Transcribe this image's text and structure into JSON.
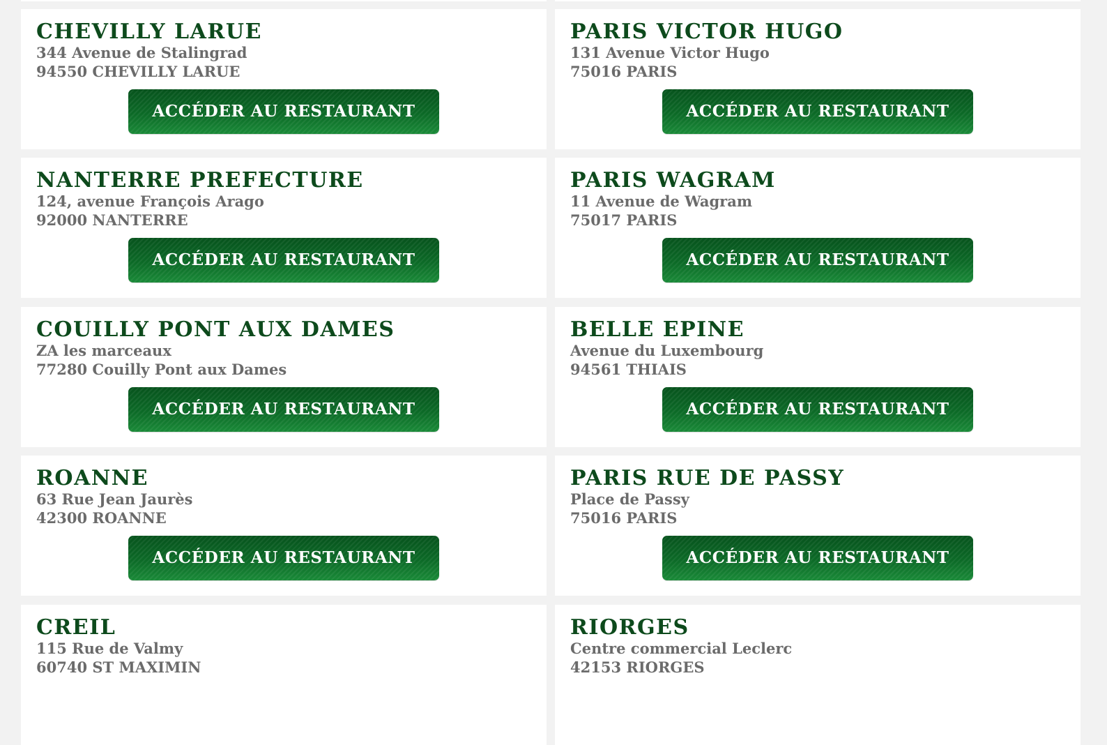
{
  "restaurants": [
    {
      "name": "CHEVILLY LARUE",
      "address_line1": "344 Avenue de Stalingrad",
      "address_line2": "94550 CHEVILLY LARUE",
      "button_label": "ACCÉDER AU RESTAURANT"
    },
    {
      "name": "PARIS VICTOR HUGO",
      "address_line1": "131 Avenue Victor Hugo",
      "address_line2": "75016 PARIS",
      "button_label": "ACCÉDER AU RESTAURANT"
    },
    {
      "name": "NANTERRE PREFECTURE",
      "address_line1": "124, avenue François Arago",
      "address_line2": "92000 NANTERRE",
      "button_label": "ACCÉDER AU RESTAURANT"
    },
    {
      "name": "PARIS WAGRAM",
      "address_line1": "11 Avenue de Wagram",
      "address_line2": "75017 PARIS",
      "button_label": "ACCÉDER AU RESTAURANT"
    },
    {
      "name": "COUILLY PONT AUX DAMES",
      "address_line1": "ZA les marceaux",
      "address_line2": "77280 Couilly Pont aux Dames",
      "button_label": "ACCÉDER AU RESTAURANT"
    },
    {
      "name": "BELLE EPINE",
      "address_line1": "Avenue du Luxembourg",
      "address_line2": "94561 THIAIS",
      "button_label": "ACCÉDER AU RESTAURANT"
    },
    {
      "name": "ROANNE",
      "address_line1": "63 Rue Jean Jaurès",
      "address_line2": "42300 ROANNE",
      "button_label": "ACCÉDER AU RESTAURANT"
    },
    {
      "name": "PARIS RUE DE PASSY",
      "address_line1": "Place de Passy",
      "address_line2": "75016 PARIS",
      "button_label": "ACCÉDER AU RESTAURANT"
    },
    {
      "name": "CREIL",
      "address_line1": "115 Rue de Valmy",
      "address_line2": "60740 ST MAXIMIN"
    },
    {
      "name": "RIORGES",
      "address_line1": "Centre commercial Leclerc",
      "address_line2": "42153 RIORGES"
    }
  ],
  "colors": {
    "page_background": "#f2f2f2",
    "card_background": "#ffffff",
    "name_text": "#0d4a1c",
    "address_text": "#6b6b6b",
    "button_green": "#0c6a27",
    "button_text": "#ffffff"
  }
}
